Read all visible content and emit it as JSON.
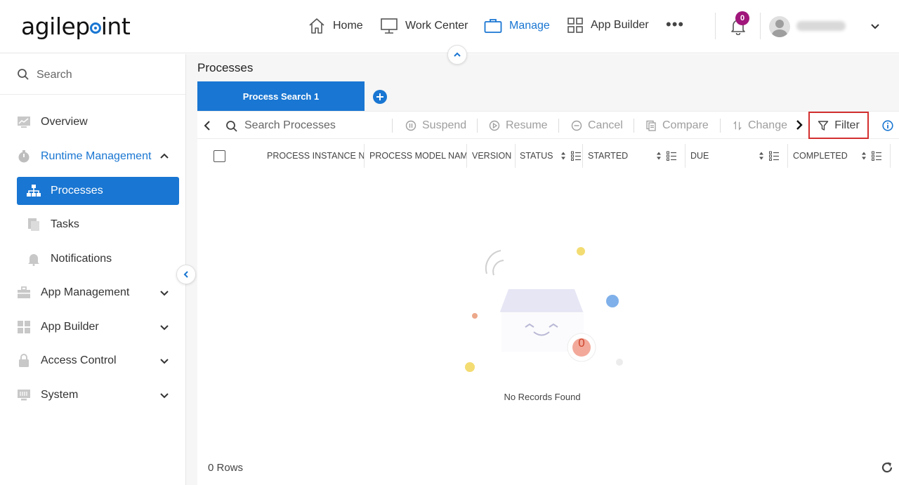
{
  "header": {
    "logo": "agilepoint",
    "nav": [
      {
        "label": "Home",
        "icon": "home-icon"
      },
      {
        "label": "Work Center",
        "icon": "monitor-icon"
      },
      {
        "label": "Manage",
        "icon": "briefcase-icon",
        "active": true
      },
      {
        "label": "App Builder",
        "icon": "grid-icon"
      }
    ],
    "more": "•••",
    "notification_count": "0"
  },
  "sidebar": {
    "search_placeholder": "Search",
    "items": [
      {
        "label": "Overview",
        "icon": "chart-icon"
      },
      {
        "label": "Runtime Management",
        "icon": "stopwatch-icon",
        "expanded": true
      },
      {
        "label": "Processes",
        "icon": "hierarchy-icon",
        "active": true
      },
      {
        "label": "Tasks",
        "icon": "tasks-icon"
      },
      {
        "label": "Notifications",
        "icon": "bell-icon"
      },
      {
        "label": "App Management",
        "icon": "toolbox-icon"
      },
      {
        "label": "App Builder",
        "icon": "grid-icon"
      },
      {
        "label": "Access Control",
        "icon": "lock-icon"
      },
      {
        "label": "System",
        "icon": "server-icon"
      }
    ]
  },
  "main": {
    "title": "Processes",
    "tab_label": "Process Search 1",
    "toolbar": {
      "search_placeholder": "Search Processes",
      "suspend": "Suspend",
      "resume": "Resume",
      "cancel": "Cancel",
      "compare": "Compare",
      "change": "Change",
      "filter": "Filter"
    },
    "columns": [
      "PROCESS INSTANCE N",
      "PROCESS MODEL NAM",
      "VERSION",
      "STATUS",
      "STARTED",
      "DUE",
      "COMPLETED"
    ],
    "empty_count": "0",
    "empty_message": "No Records Found",
    "rows_label": "0 Rows"
  },
  "colors": {
    "accent": "#1976d2",
    "badge": "#a0167a",
    "filter_highlight": "#d32f2f"
  }
}
